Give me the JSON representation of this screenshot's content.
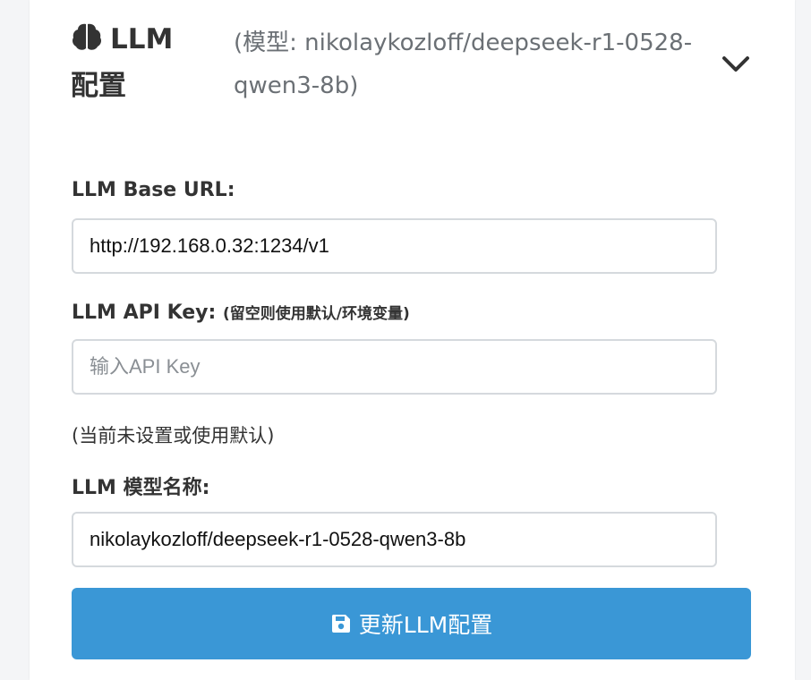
{
  "section": {
    "icon": "brain-icon",
    "title": "LLM 配置",
    "model_hint": "(模型: nikolaykozloff/deepseek-r1-0528-qwen3-8b)",
    "toggle_icon": "chevron-down-icon"
  },
  "form": {
    "base_url_label": "LLM Base URL:",
    "base_url_value": "http://192.168.0.32:1234/v1",
    "api_key_label": "LLM API Key:",
    "api_key_hint": "(留空则使用默认/环境变量)",
    "api_key_placeholder": "输入API Key",
    "api_key_status": "(当前未设置或使用默认)",
    "model_label": "LLM 模型名称:",
    "model_value": "nikolaykozloff/deepseek-r1-0528-qwen3-8b",
    "submit_icon": "save-icon",
    "submit_label": "更新LLM配置"
  },
  "colors": {
    "accent": "#3a97d6",
    "text": "#333333",
    "muted": "#6b7075",
    "border": "#d5d9dd"
  }
}
